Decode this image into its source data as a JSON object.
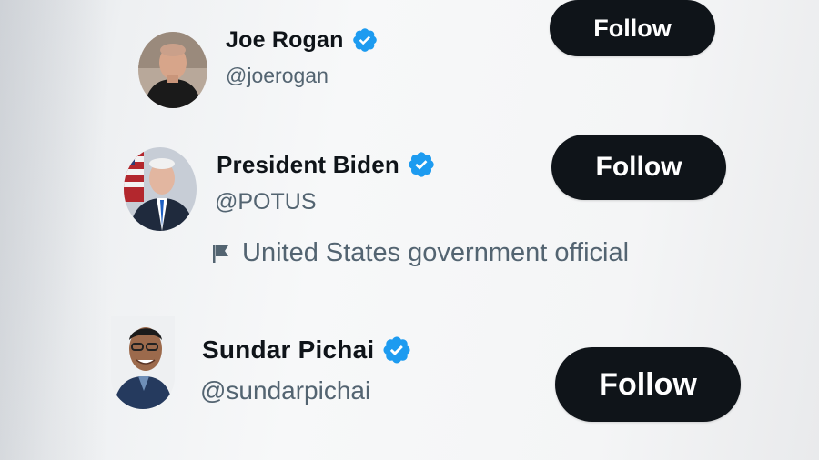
{
  "accounts": [
    {
      "name": "Joe Rogan",
      "handle": "@joerogan",
      "verified": true,
      "follow_label": "Follow"
    },
    {
      "name": "President Biden",
      "handle": "@POTUS",
      "verified": true,
      "follow_label": "Follow",
      "label": "United States government official"
    },
    {
      "name": "Sundar Pichai",
      "handle": "@sundarpichai",
      "verified": true,
      "follow_label": "Follow"
    }
  ],
  "colors": {
    "verified_badge": "#1d9bf0",
    "follow_button_bg": "#0f1419",
    "follow_button_text": "#ffffff",
    "name_text": "#0f1419",
    "secondary_text": "#536471"
  },
  "icons": {
    "verified": "verified-badge-icon",
    "government_label": "flag-icon"
  }
}
